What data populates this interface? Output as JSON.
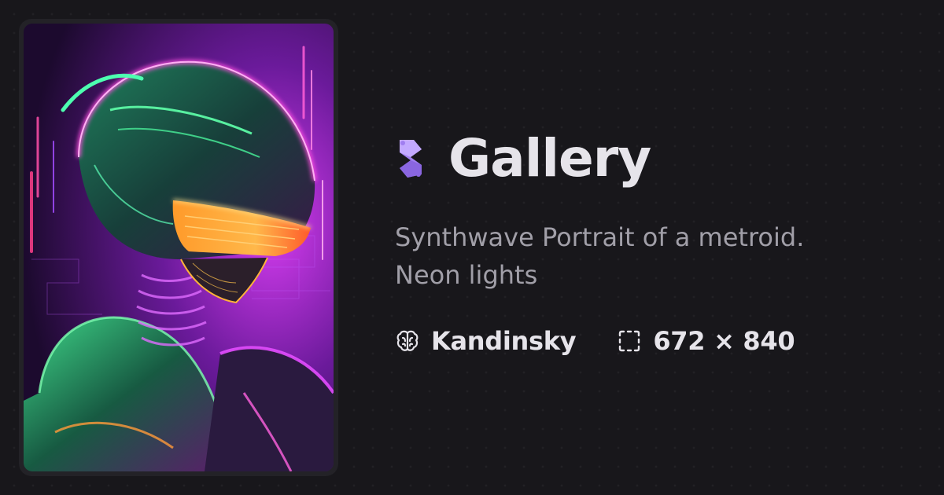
{
  "artwork": {
    "image_icon": "neon-metroid-portrait"
  },
  "header": {
    "logo_icon": "gallery-logo-icon",
    "title": "Gallery"
  },
  "description": "Synthwave Portrait of a metroid. Neon lights",
  "meta": {
    "model_icon": "brain-icon",
    "model": "Kandinsky",
    "size_icon": "dimensions-icon",
    "dimensions": "672 × 840"
  },
  "colors": {
    "background": "#18171b",
    "card": "#232227",
    "title": "#e6e4ea",
    "description": "#a19fa8",
    "logo_accent": "#a07ef0"
  }
}
